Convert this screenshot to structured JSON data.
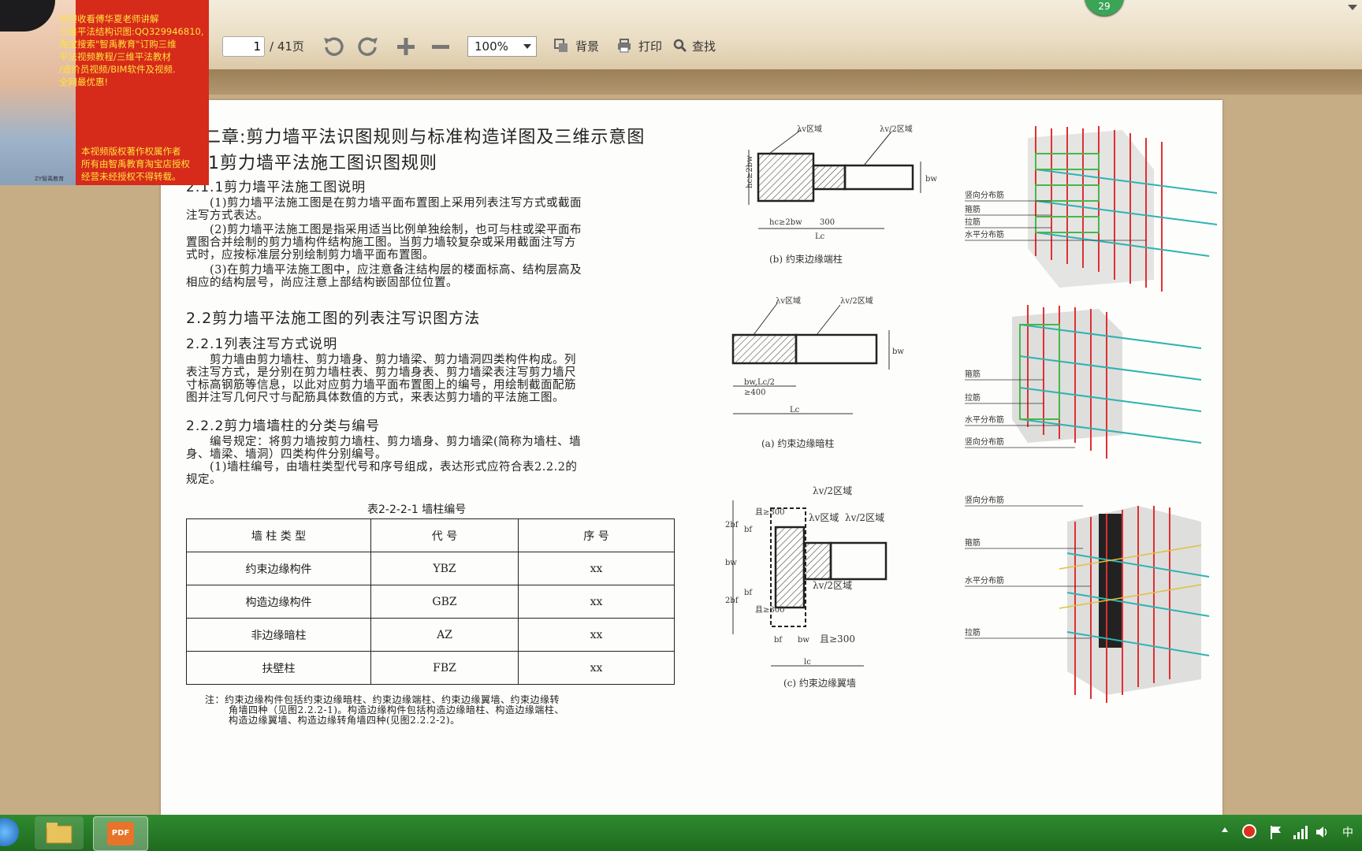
{
  "toolbar": {
    "page_current": "1",
    "page_total": "/ 41页",
    "zoom": "100%",
    "background_label": "背景",
    "print_label": "打印",
    "find_label": "查找",
    "badge": "29"
  },
  "overlay_ad": {
    "lines": [
      "欢迎收看傅华夏老师讲解",
      "三维平法结构识图:QQ329946810,",
      "淘宝搜索\"智禹教育\"订购三维",
      "平法视频教程/三维平法教材",
      "/造价员视频/BIM软件及视频.",
      "全网最优惠!"
    ],
    "copyright_lines": [
      "本视频版权著作权属作者",
      "所有由智禹教育淘宝店授权",
      "经营未经授权不得转载。"
    ],
    "shirt_logo": "ZY智禹教育"
  },
  "document": {
    "chapter_title": "二章:剪力墙平法识图规则与标准构造详图及三维示意图",
    "section_2_1": "1剪力墙平法施工图识图规则",
    "section_2_1_1": "2.1.1剪力墙平法施工图说明",
    "para_1": [
      "(1)剪力墙平法施工图是在剪力墙平面布置图上采用列表注写方式或截面",
      "注写方式表达。"
    ],
    "para_2": [
      "(2)剪力墙平法施工图是指采用适当比例单独绘制，也可与柱或梁平面布",
      "置图合并绘制的剪力墙构件结构施工图。当剪力墙较复杂或采用截面注写方",
      "式时，应按标准层分别绘制剪力墙平面布置图。"
    ],
    "para_3": [
      "(3)在剪力墙平法施工图中，应注意备注结构层的楼面标高、结构层高及",
      "相应的结构层号，尚应注意上部结构嵌固部位位置。"
    ],
    "section_2_2": "2.2剪力墙平法施工图的列表注写识图方法",
    "section_2_2_1": "2.2.1列表注写方式说明",
    "para_4": [
      "剪力墙由剪力墙柱、剪力墙身、剪力墙梁、剪力墙洞四类构件构成。列",
      "表注写方式，是分别在剪力墙柱表、剪力墙身表、剪力墙梁表注写剪力墙尺",
      "寸标高钢筋等信息，以此对应剪力墙平面布置图上的编号，用绘制截面配筋",
      "图并注写几何尺寸与配筋具体数值的方式，来表达剪力墙的平法施工图。"
    ],
    "section_2_2_2": "2.2.2剪力墙墙柱的分类与编号",
    "para_5": [
      "编号规定：将剪力墙按剪力墙柱、剪力墙身、剪力墙梁(简称为墙柱、墙",
      "身、墙梁、墙洞）四类构件分别编号。",
      "(1)墙柱编号，由墙柱类型代号和序号组成，表达形式应符合表2.2.2的",
      "规定。"
    ],
    "table_caption": "表2-2-2-1   墙柱编号",
    "table_headers": [
      "墙 柱 类 型",
      "代 号",
      "序 号"
    ],
    "table_rows": [
      [
        "约束边缘构件",
        "YBZ",
        "xx"
      ],
      [
        "构造边缘构件",
        "GBZ",
        "xx"
      ],
      [
        "非边缘暗柱",
        "AZ",
        "xx"
      ],
      [
        "扶壁柱",
        "FBZ",
        "xx"
      ]
    ],
    "note": [
      "注：约束边缘构件包括约束边缘暗柱、约束边缘端柱、约束边缘翼墙、约束边缘转",
      "角墙四种（见图2.2.2-1)。构造边缘构件包括构造边缘暗柱、构造边缘端柱、",
      "构造边缘翼墙、构造边缘转角墙四种(见图2.2.2-2)。"
    ]
  },
  "diagrams": {
    "b": {
      "caption": "(b) 约束边缘端柱",
      "region_lv": "λv区域",
      "region_lv2": "λv/2区域",
      "hc": "hc≥2bw",
      "hc_bottom": "hc≥2bw",
      "dim_300": "300",
      "lc": "Lc",
      "bw": "bw",
      "labels": [
        "竖向分布筋",
        "箍筋",
        "拉筋",
        "水平分布筋"
      ]
    },
    "a": {
      "caption": "(a) 约束边缘暗柱",
      "region_lv": "λv区域",
      "region_lv2": "λv/2区域",
      "dim_bw": "bw,Lc/2",
      "dim_400": "≥400",
      "lc": "Lc",
      "bw": "bw",
      "labels": [
        "箍筋",
        "拉筋",
        "水平分布筋",
        "竖向分布筋"
      ]
    },
    "c": {
      "caption": "(c) 约束边缘翼墙",
      "region_lv2_top": "λv/2区域",
      "region_lv": "λv区域",
      "region_lv2_right": "λv/2区域",
      "region_lv2_bottom": "λv/2区域",
      "dim_2bf_top": "2bf",
      "dim_bf_top": "bf",
      "dim_300_top": "且≥300",
      "dim_bw": "bw",
      "dim_2bf_bottom": "2bf",
      "dim_bf_bottom": "bf",
      "dim_300_bottom": "且≥300",
      "dim_bf": "bf",
      "dim_bw2": "bw",
      "dim_300": "且≥300",
      "lc": "lc",
      "labels": [
        "竖向分布筋",
        "箍筋",
        "水平分布筋",
        "拉筋"
      ]
    }
  },
  "taskbar": {
    "tray_ime": "中",
    "pdf_label": "PDF"
  },
  "colors": {
    "rebar_red": "#e03030",
    "rebar_cyan": "#2fb3b0",
    "rebar_green": "#4ab54a",
    "rebar_yellow": "#e0c040",
    "ad_red": "#d62a1b",
    "ad_yellow": "#ffe23a"
  }
}
